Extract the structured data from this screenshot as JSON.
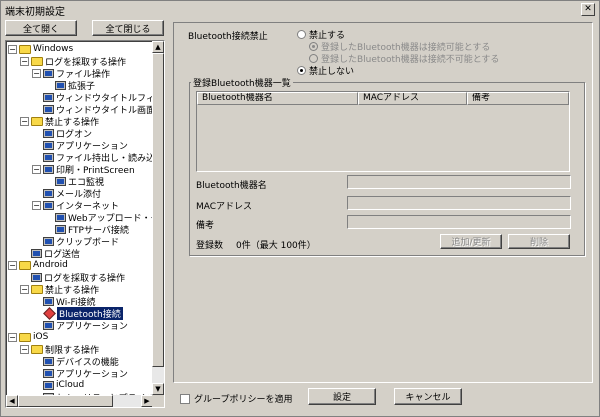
{
  "window": {
    "title": "端末初期設定",
    "close_glyph": "✕"
  },
  "toolbar": {
    "expand_all": "全て開く",
    "collapse_all": "全て閉じる"
  },
  "tree": [
    {
      "label": "Windows",
      "level": 0,
      "icon": "folder-icon",
      "expander": "−"
    },
    {
      "label": "ログを採取する操作",
      "level": 1,
      "icon": "folder-icon",
      "expander": "−"
    },
    {
      "label": "ファイル操作",
      "level": 2,
      "icon": "screen-icon",
      "expander": "−"
    },
    {
      "label": "拡張子",
      "level": 3,
      "icon": "screen-icon",
      "expander": ""
    },
    {
      "label": "ウィンドウタイトルフィル",
      "level": 2,
      "icon": "screen-icon",
      "expander": ""
    },
    {
      "label": "ウィンドウタイトル画面キ",
      "level": 2,
      "icon": "screen-icon",
      "expander": ""
    },
    {
      "label": "禁止する操作",
      "level": 1,
      "icon": "folder-icon",
      "expander": "−"
    },
    {
      "label": "ログオン",
      "level": 2,
      "icon": "screen-icon",
      "expander": ""
    },
    {
      "label": "アプリケーション",
      "level": 2,
      "icon": "screen-icon",
      "expander": ""
    },
    {
      "label": "ファイル持出し・読み込",
      "level": 2,
      "icon": "screen-icon",
      "expander": ""
    },
    {
      "label": "印刷・PrintScreen",
      "level": 2,
      "icon": "screen-icon",
      "expander": "−"
    },
    {
      "label": "エコ監視",
      "level": 3,
      "icon": "screen-icon",
      "expander": ""
    },
    {
      "label": "メール添付",
      "level": 2,
      "icon": "screen-icon",
      "expander": ""
    },
    {
      "label": "インターネット",
      "level": 2,
      "icon": "screen-icon",
      "expander": "−"
    },
    {
      "label": "Webアップロード・ダ",
      "level": 3,
      "icon": "screen-icon",
      "expander": ""
    },
    {
      "label": "FTPサーバ接続",
      "level": 3,
      "icon": "screen-icon",
      "expander": ""
    },
    {
      "label": "クリップボード",
      "level": 2,
      "icon": "screen-icon",
      "expander": ""
    },
    {
      "label": "ログ送信",
      "level": 1,
      "icon": "screen-icon",
      "expander": ""
    },
    {
      "label": "Android",
      "level": 0,
      "icon": "folder-icon",
      "expander": "−"
    },
    {
      "label": "ログを採取する操作",
      "level": 1,
      "icon": "screen-icon",
      "expander": ""
    },
    {
      "label": "禁止する操作",
      "level": 1,
      "icon": "folder-icon",
      "expander": "−"
    },
    {
      "label": "Wi-Fi接続",
      "level": 2,
      "icon": "screen-icon",
      "expander": ""
    },
    {
      "label": "Bluetooth接続",
      "level": 2,
      "icon": "diamond-icon",
      "expander": "",
      "selected": true
    },
    {
      "label": "アプリケーション",
      "level": 2,
      "icon": "screen-icon",
      "expander": ""
    },
    {
      "label": "iOS",
      "level": 0,
      "icon": "folder-icon",
      "expander": "−"
    },
    {
      "label": "制限する操作",
      "level": 1,
      "icon": "folder-icon",
      "expander": "−"
    },
    {
      "label": "デバイスの機能",
      "level": 2,
      "icon": "screen-icon",
      "expander": ""
    },
    {
      "label": "アプリケーション",
      "level": 2,
      "icon": "screen-icon",
      "expander": ""
    },
    {
      "label": "iCloud",
      "level": 2,
      "icon": "screen-icon",
      "expander": ""
    },
    {
      "label": "セキュリティとプライバシ",
      "level": 2,
      "icon": "screen-icon",
      "expander": ""
    }
  ],
  "scroll": {
    "up": "▲",
    "down": "▼",
    "left": "◀",
    "right": "▶"
  },
  "settings": {
    "label": "Bluetooth接続禁止",
    "option_prohibit": "禁止する",
    "sub_allow": "登録したBluetooth機器は接続可能とする",
    "sub_deny": "登録したBluetooth機器は接続不可能とする",
    "option_allow": "禁止しない"
  },
  "devices": {
    "group_title": "登録Bluetooth機器一覧",
    "columns": [
      "Bluetooth機器名",
      "MACアドレス",
      "備考"
    ],
    "name_label": "Bluetooth機器名",
    "mac_label": "MACアドレス",
    "note_label": "備考",
    "count_label": "登録数",
    "count_value": "0件（最大 100件）",
    "add_button": "追加/更新",
    "delete_button": "削除"
  },
  "footer": {
    "group_policy": "グループポリシーを適用",
    "set_button": "設定",
    "cancel_button": "キャンセル"
  }
}
